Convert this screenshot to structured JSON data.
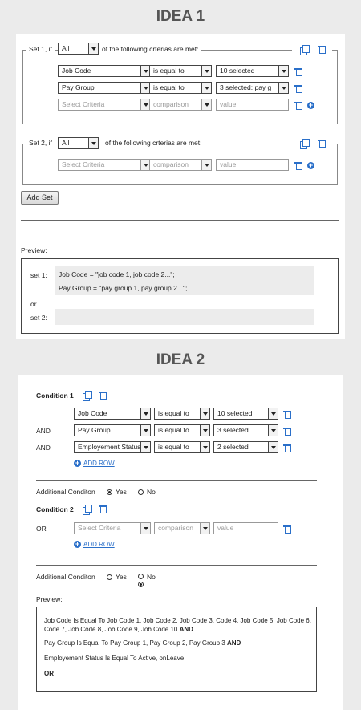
{
  "idea1": {
    "heading": "IDEA 1",
    "set1": {
      "prefix": "Set 1, if",
      "quantifier": "All",
      "suffix": "of the following crterias are met:",
      "rows": [
        {
          "criteria": "Job Code",
          "comparison": "is equal to",
          "value": "10 selected"
        },
        {
          "criteria": "Pay Group",
          "comparison": "is equal to",
          "value": "3 selected: pay g"
        }
      ],
      "new_row": {
        "criteria_placeholder": "Select Criteria",
        "comparison_placeholder": "comparison",
        "value_placeholder": "value"
      }
    },
    "set2": {
      "prefix": "Set 2, if",
      "quantifier": "All",
      "suffix": "of the following crterias are met:",
      "new_row": {
        "criteria_placeholder": "Select Criteria",
        "comparison_placeholder": "comparison",
        "value_placeholder": "value"
      }
    },
    "add_set_label": "Add Set",
    "preview_label": "Preview:",
    "preview": {
      "set1_label": "set 1:",
      "set1_line1": "Job Code = \"job code 1, job code 2...\";",
      "set1_line2": "Pay Group = \"pay group 1, pay group 2...\";",
      "or_label": "or",
      "set2_label": "set 2:"
    }
  },
  "idea2": {
    "heading": "IDEA 2",
    "condition1": {
      "title": "Condition 1",
      "rows": [
        {
          "connector": "",
          "criteria": "Job Code",
          "comparison": "is equal to",
          "value": "10 selected"
        },
        {
          "connector": "AND",
          "criteria": "Pay Group",
          "comparison": "is equal to",
          "value": "3 selected"
        },
        {
          "connector": "AND",
          "criteria": "Employement Status",
          "comparison": "is equal to",
          "value": "2 selected"
        }
      ],
      "add_row_label": "ADD ROW"
    },
    "additional1": {
      "label": "Additional Conditon",
      "yes": "Yes",
      "no": "No"
    },
    "condition2": {
      "title": "Condition 2",
      "connector": "OR",
      "criteria_placeholder": "Select Criteria",
      "comparison_placeholder": "comparison",
      "value_placeholder": "value",
      "add_row_label": "ADD ROW"
    },
    "additional2": {
      "label": "Additional Conditon",
      "yes": "Yes",
      "no": "No"
    },
    "preview_label": "Preview:",
    "preview": {
      "line1a": "Job Code Is Equal To Job Code 1, Job Code 2, Job Code 3, Code 4, Job Code 5, Job Code 6,",
      "line1b": "Code 7, Job Code 8, Job Code 9, Job Code 10",
      "and1": "AND",
      "line2": "Pay Group Is Equal To Pay Group 1, Pay Group 2, Pay Group 3",
      "and2": "AND",
      "line3": "Employement Status Is Equal To Active, onLeave",
      "or": "OR"
    }
  }
}
